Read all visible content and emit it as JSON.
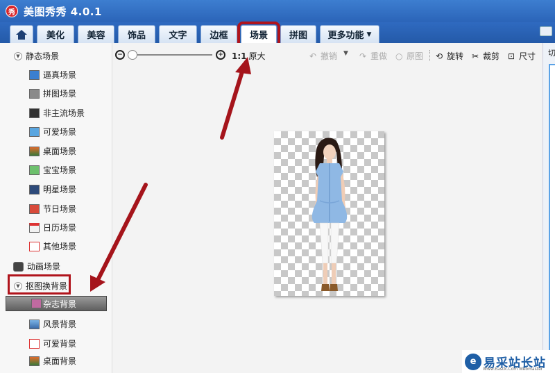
{
  "app": {
    "logo_char": "秀",
    "title": "美图秀秀 4.0.1"
  },
  "tabs": [
    {
      "label": "美化"
    },
    {
      "label": "美容"
    },
    {
      "label": "饰品"
    },
    {
      "label": "文字"
    },
    {
      "label": "边框"
    },
    {
      "label": "场景",
      "active": true
    },
    {
      "label": "拼图"
    },
    {
      "label": "更多功能",
      "dropdown": true
    }
  ],
  "sidebar": {
    "static_group": "静态场景",
    "static_items": [
      "逼真场景",
      "拼图场景",
      "非主流场景",
      "可爱场景",
      "桌面场景",
      "宝宝场景",
      "明星场景",
      "节日场景",
      "日历场景",
      "其他场景"
    ],
    "animated_group": "动画场景",
    "cutout_group": "抠图换背景",
    "cutout_items": [
      "杂志背景",
      "风景背景",
      "可爱背景",
      "桌面背景"
    ],
    "selected_item": "杂志背景"
  },
  "toolbar": {
    "zoom_out_icon": "zoom-out-icon",
    "zoom_in_icon": "zoom-in-icon",
    "actual_size_prefix": "1:1",
    "actual_size": "原大",
    "undo": "撤销",
    "redo": "重做",
    "original": "原图",
    "rotate": "旋转",
    "crop": "裁剪",
    "resize": "尺寸"
  },
  "right_panel": {
    "label": "切"
  },
  "watermark": {
    "logo_char": "e",
    "text": "易采站长站",
    "url": "Www.Easck.Com  Webmaster"
  },
  "colors": {
    "accent": "#2b64b8",
    "highlight_red": "#b0141c",
    "selected_row": "#7a7a7a"
  }
}
